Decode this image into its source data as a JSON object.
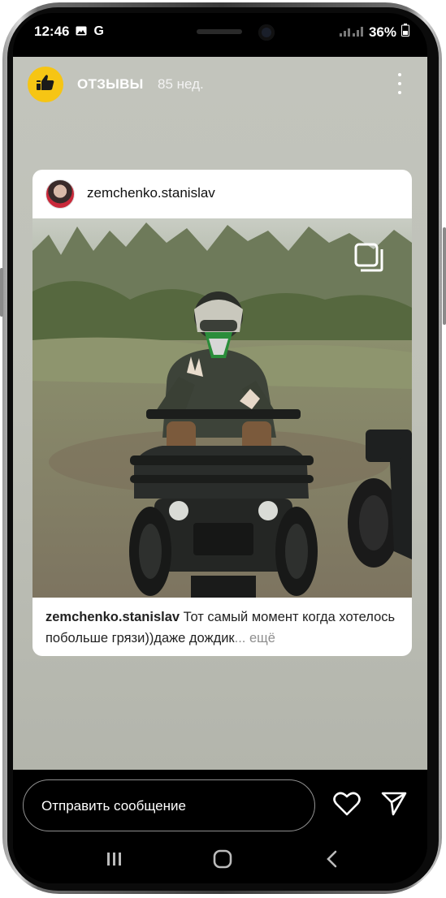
{
  "status_bar": {
    "time": "12:46",
    "notification_icons": [
      "image-icon",
      "google-icon"
    ],
    "battery": "36%"
  },
  "story": {
    "title": "ОТЗЫВЫ",
    "posted_ago": "85 нед.",
    "post": {
      "username": "zemchenko.stanislav",
      "caption_username": "zemchenko.stanislav",
      "caption_text": " Тот самый момент когда хотелось побольше грязи))даже дождик",
      "more_label": "... ещё"
    }
  },
  "reply": {
    "placeholder": "Отправить сообщение"
  },
  "colors": {
    "story_bg": "#c2c4bc",
    "brand_yellow": "#f6c514"
  }
}
